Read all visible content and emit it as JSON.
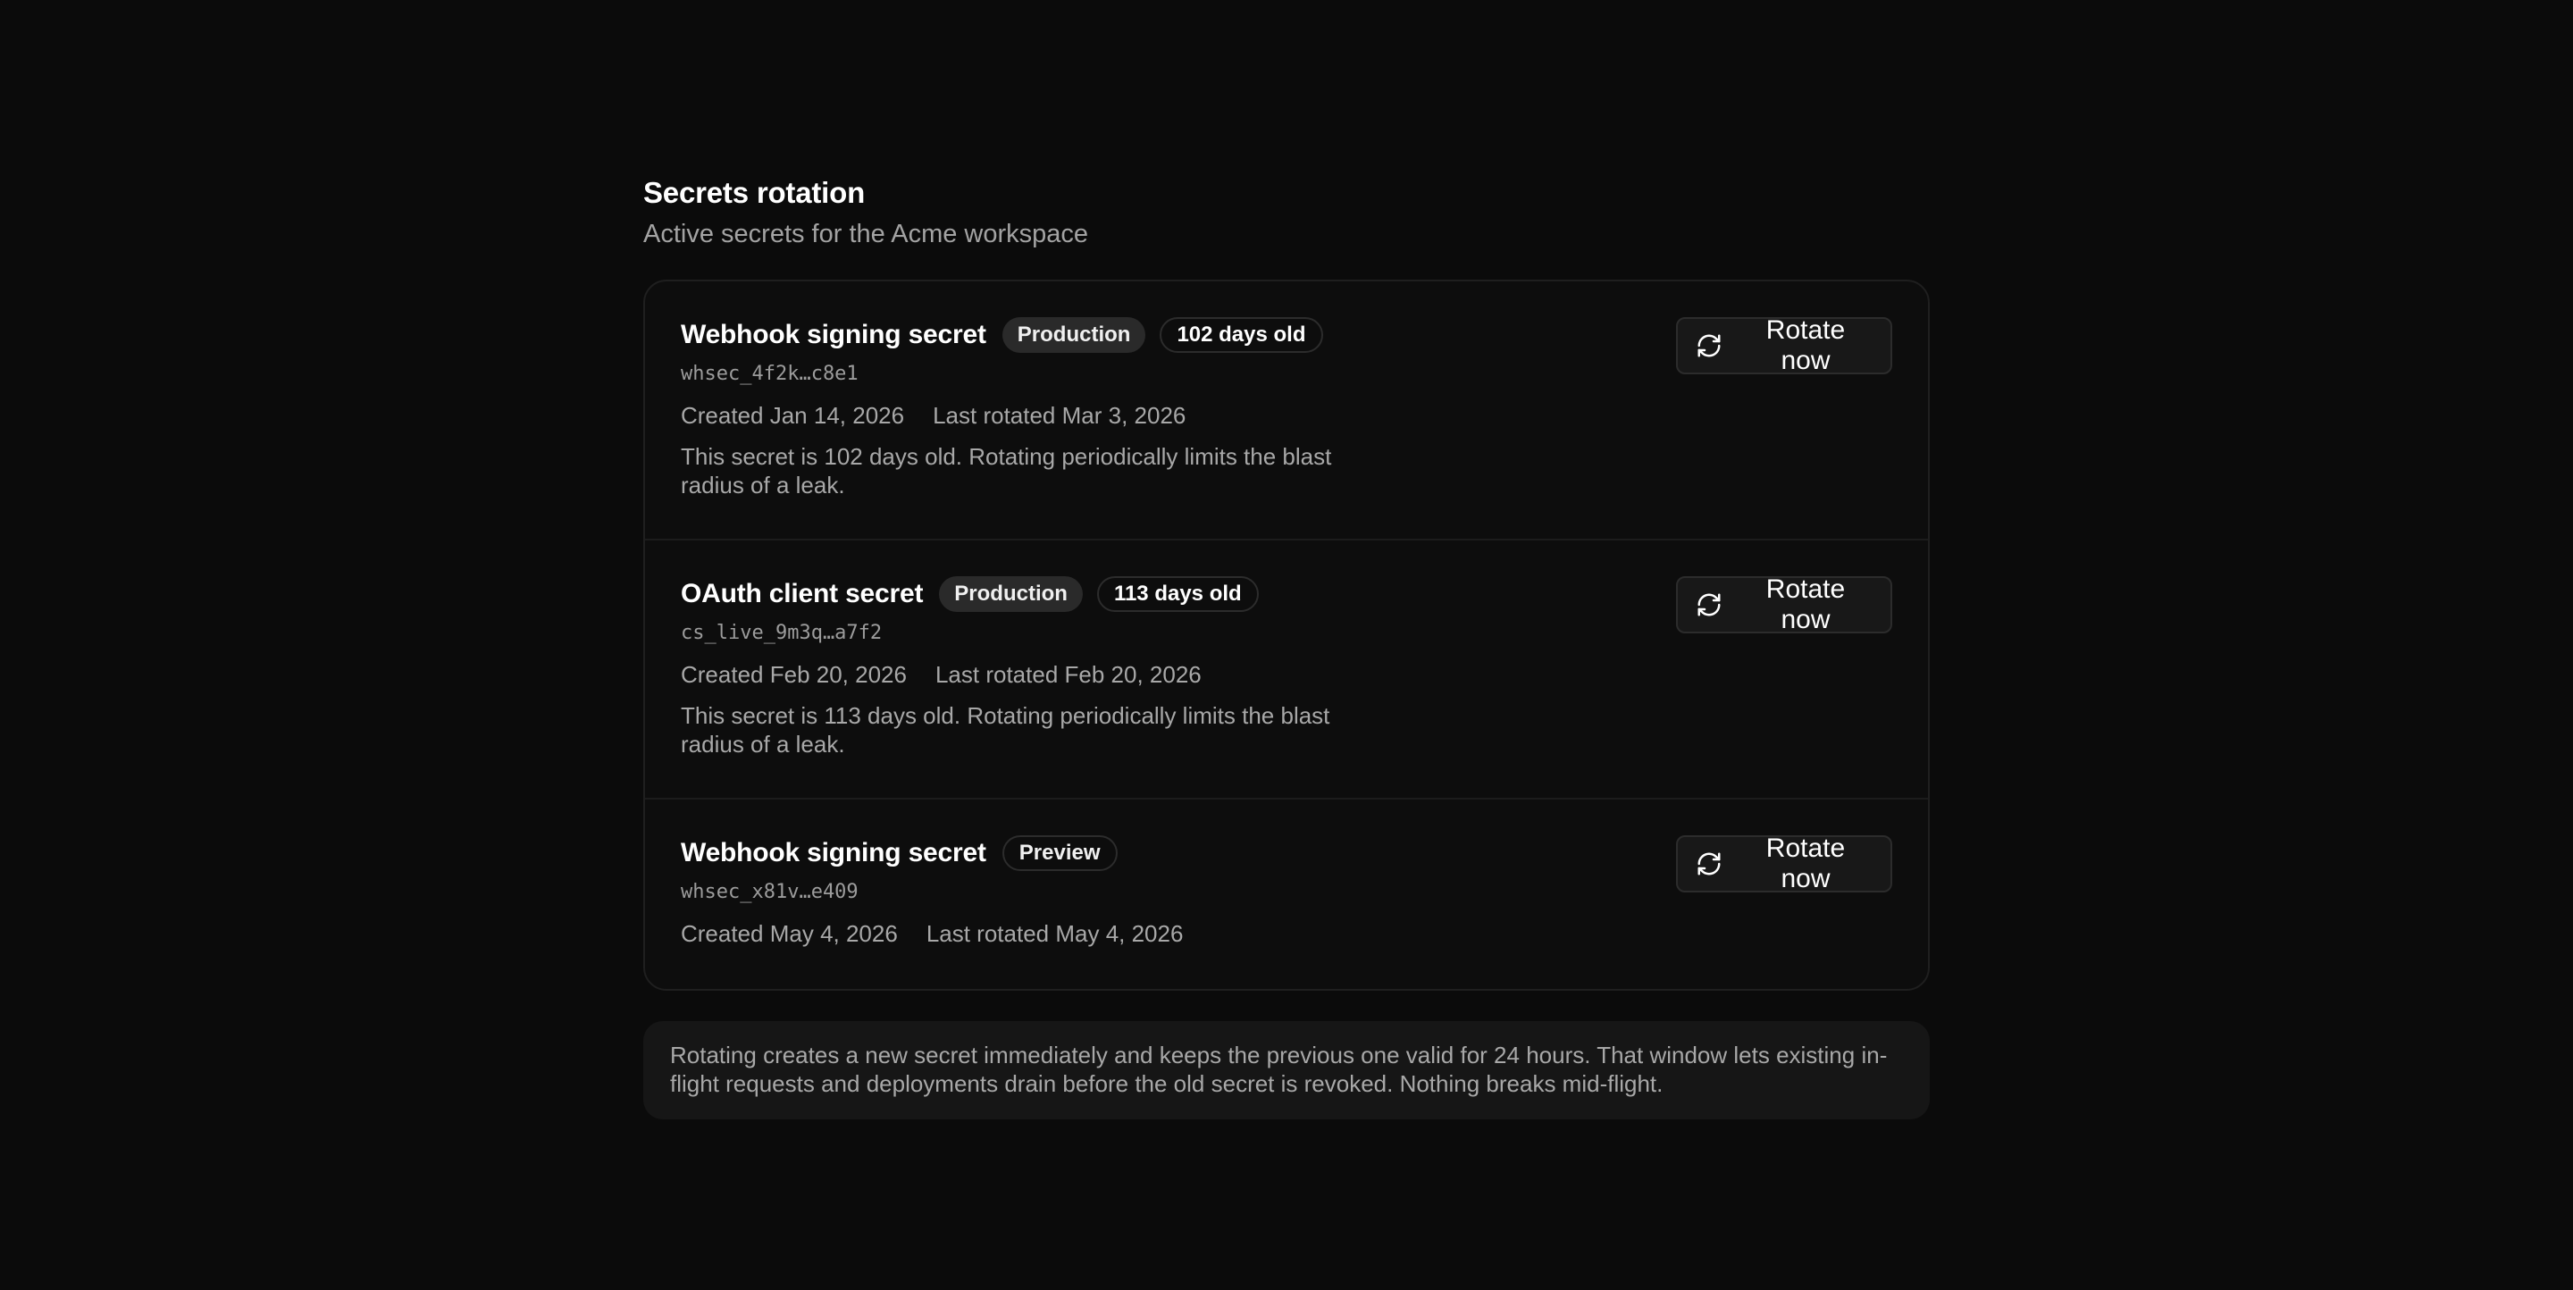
{
  "header": {
    "title": "Secrets rotation",
    "subtitle": "Active secrets for the Acme workspace"
  },
  "secrets": [
    {
      "name": "Webhook signing secret",
      "environment": "Production",
      "age_badge": "102 days old",
      "id": "whsec_4f2k…c8e1",
      "created": "Created Jan 14, 2026",
      "last_rotated": "Last rotated Mar 3, 2026",
      "note": "This secret is 102 days old. Rotating periodically limits the blast radius of a leak.",
      "action_label": "Rotate now",
      "action_icon": "refresh-icon"
    },
    {
      "name": "OAuth client secret",
      "environment": "Production",
      "age_badge": "113 days old",
      "id": "cs_live_9m3q…a7f2",
      "created": "Created Feb 20, 2026",
      "last_rotated": "Last rotated Feb 20, 2026",
      "note": "This secret is 113 days old. Rotating periodically limits the blast radius of a leak.",
      "action_label": "Rotate now",
      "action_icon": "refresh-icon"
    },
    {
      "name": "Webhook signing secret",
      "environment": "Preview",
      "id": "whsec_x81v…e409",
      "created": "Created May 4, 2026",
      "last_rotated": "Last rotated May 4, 2026",
      "action_label": "Rotate now",
      "action_icon": "refresh-icon"
    }
  ],
  "info": {
    "text": "Rotating creates a new secret immediately and keeps the previous one valid for 24 hours. That window lets existing in-flight requests and deployments drain before the old secret is revoked. Nothing breaks mid-flight."
  },
  "colors": {
    "background": "#0b0b0b",
    "card_border": "#1f1f1f",
    "text_primary": "#ffffff",
    "text_muted": "#a8a8a8",
    "badge_fill": "#2a2a2a",
    "button_fill": "#181818"
  }
}
